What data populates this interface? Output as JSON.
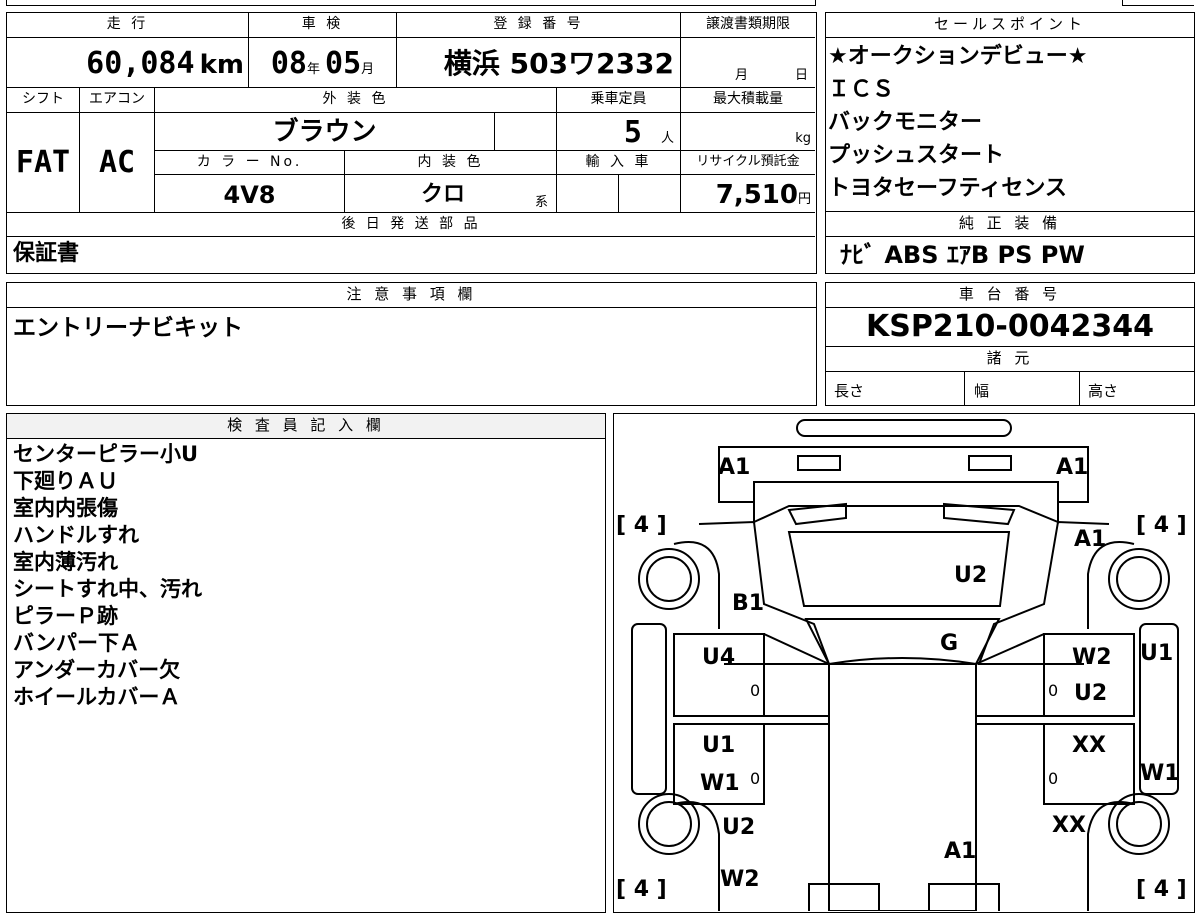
{
  "main_info": {
    "mileage_label": "走 行",
    "mileage_value": "60,084",
    "mileage_unit": "km",
    "inspection_label": "車 検",
    "inspection_year": "08",
    "inspection_year_unit": "年",
    "inspection_month": "05",
    "inspection_month_unit": "月",
    "registration_label": "登 録 番 号",
    "registration_value": "横浜 503ワ2332",
    "transfer_label": "譲渡書類期限",
    "transfer_month_unit": "月",
    "transfer_day_unit": "日",
    "shift_label": "シフト",
    "shift_value": "FAT",
    "ac_label": "エアコン",
    "ac_value": "AC",
    "exterior_color_label": "外 装 色",
    "exterior_color_value": "ブラウン",
    "seating_label": "乗車定員",
    "seating_value": "5",
    "seating_unit": "人",
    "max_load_label": "最大積載量",
    "max_load_unit": "kg",
    "color_no_label": "カ ラ ー No.",
    "color_no_value": "4V8",
    "interior_color_label": "内 装 色",
    "interior_color_value": "クロ",
    "interior_color_suffix": "系",
    "import_label": "輸 入 車",
    "recycle_label": "リサイクル預託金",
    "recycle_value": "7,510",
    "recycle_unit": "円",
    "later_parts_label": "後 日 発 送 部 品",
    "later_parts_value": "保証書"
  },
  "sales_points": {
    "label": "セールスポイント",
    "items": [
      "★オークションデビュー★",
      "ＩＣＳ",
      "バックモニター",
      "プッシュスタート",
      "トヨタセーフティセンス"
    ]
  },
  "genuine_equipment": {
    "label": "純 正 装 備",
    "value": "ﾅﾋﾞ ABS ｴｱB PS PW"
  },
  "notes": {
    "label": "注 意 事 項 欄",
    "value": "エントリーナビキット"
  },
  "chassis": {
    "label": "車 台 番 号",
    "value": "KSP210-0042344",
    "specs_label": "諸 元",
    "length_label": "長さ",
    "width_label": "幅",
    "height_label": "高さ"
  },
  "inspector": {
    "label": "検 査 員 記 入 欄",
    "items": [
      "センターピラー小U",
      "下廻りＡＵ",
      "室内内張傷",
      "ハンドルすれ",
      "室内薄汚れ",
      "シートすれ中、汚れ",
      "ピラーＰ跡",
      "バンパー下Ａ",
      "アンダーカバー欠",
      "ホイールカバーＡ"
    ]
  },
  "diagram": {
    "tire_tl": "[ 4 ]",
    "tire_tr": "[ 4 ]",
    "tire_bl": "[ 4 ]",
    "tire_br": "[ 4 ]",
    "marks": {
      "front_left": "A1",
      "front_right": "A1",
      "fender_right": "A1",
      "hood": "U2",
      "fender_left": "B1",
      "windshield": "G",
      "front_door_left": "U4",
      "front_door_right": "W2",
      "front_door_right_2": "U2",
      "sill_right_front": "U1",
      "rear_door_left": "U1",
      "rear_door_left_2": "W1",
      "rear_door_right": "XX",
      "sill_right_rear": "W1",
      "rear_fender_left": "U2",
      "rear_fender_right": "XX",
      "rear_left": "W2",
      "trunk": "A1",
      "zero_1": "0",
      "zero_2": "0",
      "zero_3": "0",
      "zero_4": "0"
    }
  }
}
